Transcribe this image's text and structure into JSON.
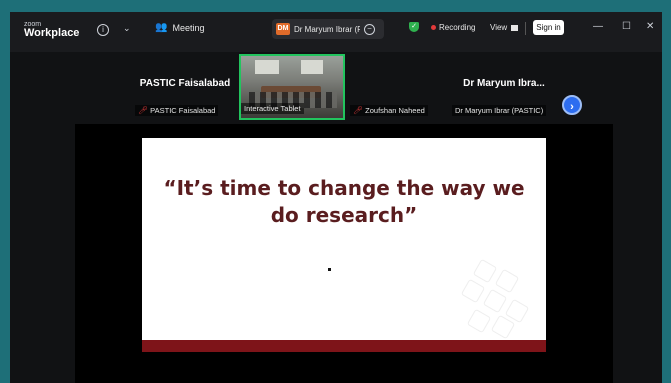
{
  "app": {
    "logo_small": "zoom",
    "logo_big": "Workplace",
    "meeting_label": "Meeting",
    "active_speaker": {
      "initials": "DM",
      "name": "Dr Maryum Ibrar (P("
    },
    "recording_label": "Recording",
    "view_label": "View",
    "signin_label": "Sign in",
    "window_controls": [
      "—",
      "☐",
      "✕"
    ]
  },
  "participants": [
    {
      "display_name": "PASTIC Faisalabad",
      "label": "PASTIC Faisalabad",
      "muted": true,
      "video": false
    },
    {
      "display_name": "",
      "label": "Interactive Tablet",
      "muted": false,
      "video": true
    },
    {
      "display_name": "",
      "label": "Zoufshan Naheed",
      "muted": true,
      "video": true
    },
    {
      "display_name": "Dr Maryum Ibra...",
      "label": "Dr Maryum Ibrar (PASTIC)",
      "muted": false,
      "video": false
    }
  ],
  "slide": {
    "line1": "“It’s time to change the way we",
    "line2": "do research”"
  },
  "colors": {
    "accent": "#2d6df0",
    "active_border": "#22c45e",
    "recording": "#e23a3a",
    "slide_title": "#5a1d1f",
    "slide_bar": "#7e1419"
  }
}
